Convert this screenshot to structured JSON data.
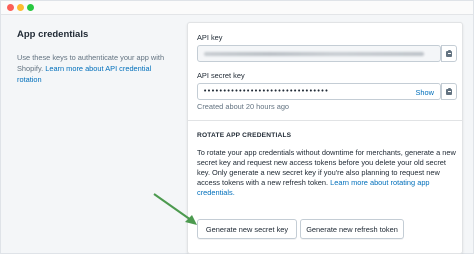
{
  "left": {
    "title": "App credentials",
    "description": "Use these keys to authenticate your app with Shopify. ",
    "learn_link": "Learn more about API credential rotation"
  },
  "api_key": {
    "label": "API key"
  },
  "api_secret": {
    "label": "API secret key",
    "masked_value": "••••••••••••••••••••••••••••••••",
    "show_label": "Show",
    "created": "Created about 20 hours ago"
  },
  "rotate": {
    "heading": "ROTATE APP CREDENTIALS",
    "description": "To rotate your app credentials without downtime for merchants, generate a new secret key and request new access tokens before you delete your old secret key. Only generate a new secret key if you're also planning to request new access tokens with a new refresh token. ",
    "learn_link": "Learn more about rotating app credentials.",
    "generate_secret_label": "Generate new secret key",
    "generate_refresh_label": "Generate new refresh token"
  },
  "colors": {
    "accent_link": "#006fbb",
    "arrow": "#4c9a4f"
  },
  "icons": [
    "clipboard-icon",
    "arrow-pointer"
  ]
}
